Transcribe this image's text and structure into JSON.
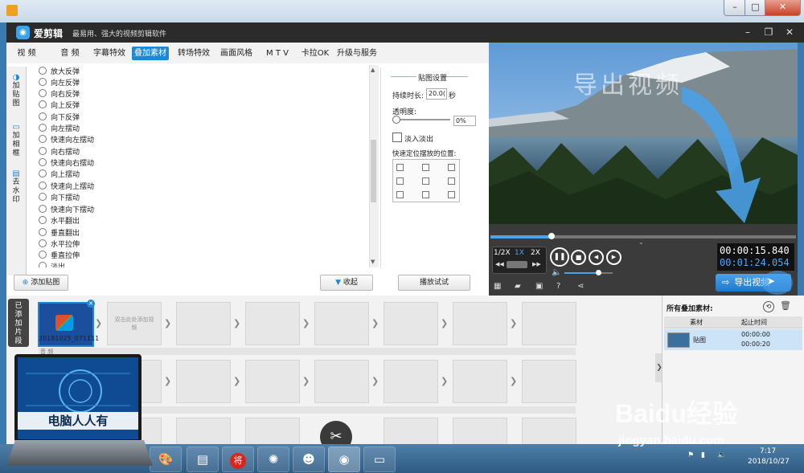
{
  "app": {
    "name": "爱剪辑",
    "slogan": "最易用、强大的视频剪辑软件"
  },
  "tabs": [
    {
      "label": "视 频"
    },
    {
      "label": "音 频"
    },
    {
      "label": "字幕特效"
    },
    {
      "label": "叠加素材",
      "active": true
    },
    {
      "label": "转场特效"
    },
    {
      "label": "画面风格"
    },
    {
      "label": "M T V"
    },
    {
      "label": "卡拉OK"
    },
    {
      "label": "升级与服务"
    }
  ],
  "side_tabs": [
    {
      "label": "加贴图",
      "icon": "sticker-icon"
    },
    {
      "label": "加相框",
      "icon": "frame-icon"
    },
    {
      "label": "去水印",
      "icon": "watermark-icon"
    }
  ],
  "effects": [
    "放大反弹",
    "向左反弹",
    "向右反弹",
    "向上反弹",
    "向下反弹",
    "向左摆动",
    "快速向左摆动",
    "向右摆动",
    "快速向右摆动",
    "向上摆动",
    "快速向上摆动",
    "向下摆动",
    "快速向下摆动",
    "水平翻出",
    "垂直翻出",
    "水平拉伸",
    "垂直拉伸",
    "淡出"
  ],
  "settings": {
    "title": "贴图设置",
    "duration_label": "持续时长:",
    "duration_value": "20.0(",
    "duration_unit": "秒",
    "opacity_label": "透明度:",
    "opacity_value": "0%",
    "fade_label": "淡入淡出",
    "position_label": "快速定位摆放的位置:",
    "preview_button": "播放试试"
  },
  "buttons": {
    "add_sticker": "添加贴图",
    "collapse": "收起",
    "export_video": "导出视频"
  },
  "preview": {
    "overlay_text": "导出视频"
  },
  "playback": {
    "speed_half": "1/2X",
    "speed_1x": "1X",
    "speed_2x": "2X",
    "time_total": "00:00:15.840",
    "time_current": "00:01:24.054",
    "progress": 0.2,
    "volume": 0.7
  },
  "timeline": {
    "label": "已添加片段",
    "clip_name": "20181025_071111",
    "add_hint": "双击此处添加视频",
    "audio_label": "音 频"
  },
  "overlay_panel": {
    "title": "所有叠加素材:",
    "col_material": "素材",
    "col_time": "起止时间",
    "row_name": "贴图",
    "row_start": "00:00:00",
    "row_end": "00:00:20"
  },
  "laptop_text": "电脑人人有",
  "watermark": {
    "brand": "Baidu经验",
    "url": "jingyan.baidu.com"
  },
  "taskbar": {
    "time": "7:17",
    "date": "2018/10/27",
    "icon_text": "将"
  },
  "colors": {
    "accent": "#1f88d6",
    "time_highlight": "#47a8ff"
  }
}
